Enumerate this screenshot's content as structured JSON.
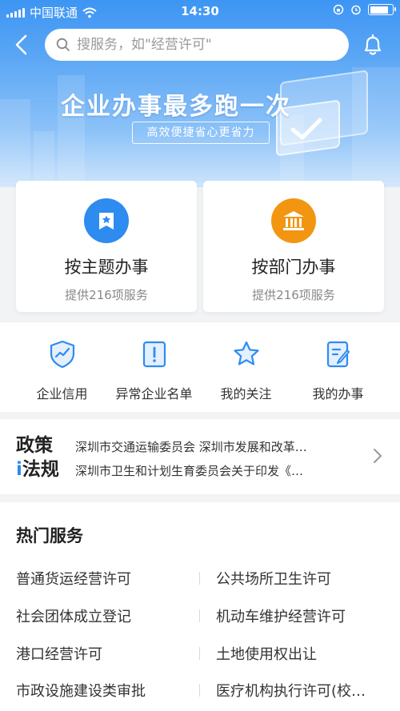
{
  "status_bar": {
    "carrier": "中国联通",
    "time": "14:30"
  },
  "search": {
    "placeholder": "搜服务，如\"经营许可\""
  },
  "banner": {
    "title": "企业办事最多跑一次",
    "subtitle": "高效便捷省心更省力"
  },
  "cards": [
    {
      "icon": "badge-icon",
      "title": "按主题办事",
      "subtitle": "提供216项服务",
      "color": "#2e8bf0"
    },
    {
      "icon": "bank-icon",
      "title": "按部门办事",
      "subtitle": "提供216项服务",
      "color": "#f29611"
    }
  ],
  "quick_links": [
    {
      "icon": "shield-chart-icon",
      "label": "企业信用"
    },
    {
      "icon": "alert-icon",
      "label": "异常企业名单"
    },
    {
      "icon": "star-icon",
      "label": "我的关注"
    },
    {
      "icon": "edit-icon",
      "label": "我的办事"
    }
  ],
  "policy": {
    "logo_line1": "政策",
    "logo_line2_accent": "i",
    "logo_line2": "法规",
    "items": [
      "深圳市交通运输委员会 深圳市发展和改革…",
      "深圳市卫生和计划生育委员会关于印发《…"
    ]
  },
  "hot_services": {
    "title": "热门服务",
    "items": [
      "普通货运经营许可",
      "公共场所卫生许可",
      "社会团体成立登记",
      "机动车维护经营许可",
      "港口经营许可",
      "土地使用权出让",
      "市政设施建设类审批",
      "医疗机构执行许可(校…"
    ]
  },
  "colors": {
    "primary": "#2e8bf0",
    "orange": "#f29611",
    "banner_top": "#3d95f3"
  }
}
